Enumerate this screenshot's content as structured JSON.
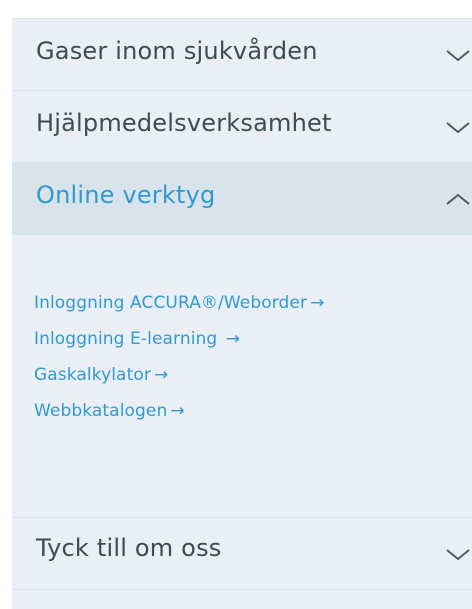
{
  "accordion": {
    "sections": [
      {
        "label": "Gaser inom sjukvården",
        "expanded": false,
        "icon": "chevron-down-icon"
      },
      {
        "label": "Hjälpmedelsverksamhet",
        "expanded": false,
        "icon": "chevron-down-icon"
      },
      {
        "label": "Online verktyg",
        "expanded": true,
        "icon": "chevron-up-icon"
      },
      {
        "label": "Tyck till om oss",
        "expanded": false,
        "icon": "chevron-down-icon"
      }
    ],
    "online_links": [
      {
        "label": "Inloggning ACCURA®/Weborder",
        "arrow": "→"
      },
      {
        "label": "Inloggning E-learning ",
        "arrow": "→"
      },
      {
        "label": "Gaskalkylator",
        "arrow": "→"
      },
      {
        "label": "Webbkatalogen",
        "arrow": "→"
      }
    ]
  },
  "colors": {
    "background": "#e9eff4",
    "open_header": "#d8e3eb",
    "text": "#3d4b57",
    "accent": "#2f9bd0"
  }
}
